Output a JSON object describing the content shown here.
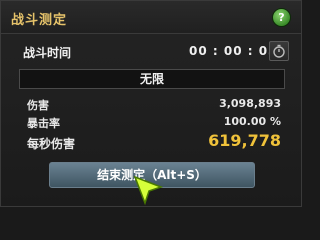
{
  "window": {
    "title": "战斗测定",
    "help_label": "?"
  },
  "timer": {
    "label": "战斗时间",
    "value": "00 : 00 : 05",
    "icon": "stopwatch-icon"
  },
  "mode": {
    "label": "无限"
  },
  "stats": {
    "damage_label": "伤害",
    "damage_value": "3,098,893",
    "crit_label": "暴击率",
    "crit_value": "100.00 %",
    "dps_label": "每秒伤害",
    "dps_value": "619,778"
  },
  "actions": {
    "end_label": "结束测定（Alt+S）"
  },
  "colors": {
    "title": "#e6c36a",
    "dps": "#f0c23a",
    "button": "#56707f",
    "help": "#4aa33a"
  }
}
